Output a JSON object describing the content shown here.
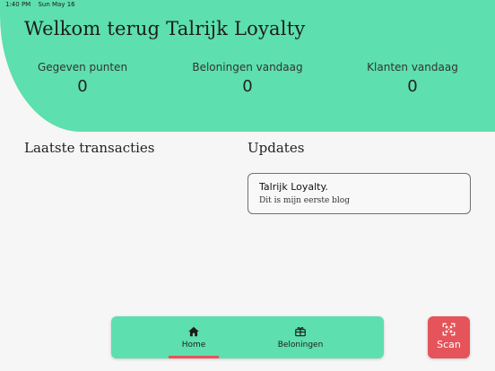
{
  "status_bar": {
    "time": "1:40 PM",
    "date": "Sun May 16"
  },
  "header": {
    "title": "Welkom terug Talrijk Loyalty",
    "stats": [
      {
        "label": "Gegeven punten",
        "value": "0"
      },
      {
        "label": "Beloningen vandaag",
        "value": "0"
      },
      {
        "label": "Klanten vandaag",
        "value": "0"
      }
    ]
  },
  "sections": {
    "transactions_title": "Laatste transacties",
    "updates_title": "Updates"
  },
  "updates": [
    {
      "title": "Talrijk Loyalty.",
      "body": "Dit is mijn eerste blog"
    }
  ],
  "bottom_nav": {
    "items": [
      {
        "label": "Home",
        "icon": "home-icon",
        "active": true
      },
      {
        "label": "Beloningen",
        "icon": "gift-icon",
        "active": false
      }
    ]
  },
  "scan_button": {
    "label": "Scan",
    "icon": "qr-scan-icon"
  },
  "colors": {
    "accent": "#5ddfaf",
    "danger": "#e5545a",
    "background": "#f6f6f6"
  }
}
